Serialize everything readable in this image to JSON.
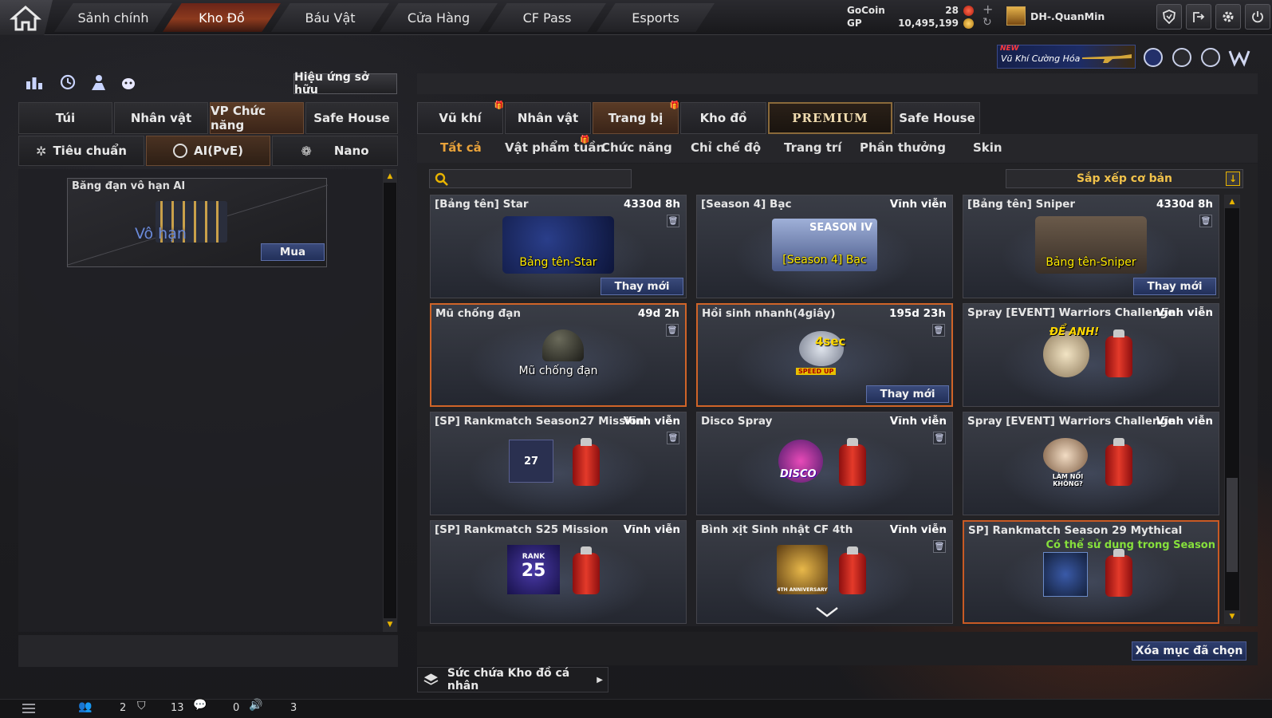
{
  "topbar": {
    "nav": [
      "Sảnh chính",
      "Kho Đồ",
      "Báu Vật",
      "Cửa Hàng",
      "CF Pass",
      "Esports"
    ],
    "active_nav": "Kho Đồ",
    "gocoin_label": "GoCoin",
    "gocoin_value": "28",
    "gp_label": "GP",
    "gp_value": "10,495,199",
    "username": "DH-.QuanMin",
    "buttons": [
      "shield-icon",
      "exit-arrow-icon",
      "gear-icon",
      "power-icon"
    ]
  },
  "banner": {
    "new_badge": "NEW",
    "text": "Vũ Khí Cường Hóa"
  },
  "left": {
    "effect_button": "Hiệu ứng sở hữu",
    "tabs": [
      "Túi",
      "Nhân vật",
      "VP Chức năng",
      "Safe House"
    ],
    "active_tab": "VP Chức năng",
    "subtabs": [
      "Tiêu chuẩn",
      "AI(PvE)",
      "Nano"
    ],
    "active_subtab": "AI(PvE)",
    "item": {
      "name": "Băng đạn vô hạn AI",
      "image_label": "Vô hạn",
      "buy_button": "Mua"
    }
  },
  "right": {
    "tabs": [
      "Vũ khí",
      "Nhân vật",
      "Trang bị",
      "Kho đồ",
      "PREMIUM",
      "Safe House"
    ],
    "active_tab": "Trang bị",
    "filters": [
      "Tất cả",
      "Vật phẩm tuần",
      "Chức năng",
      "Chỉ chế độ",
      "Trang trí",
      "Phần thưởng",
      "Skin"
    ],
    "active_filter": "Tất cả",
    "search_placeholder": "",
    "sort_label": "Sắp xếp cơ bản",
    "items": [
      {
        "name": "[Bảng tên] Star",
        "time": "4330d 8h",
        "label": "Bảng tên-Star",
        "button": "Thay mới"
      },
      {
        "name": "[Season 4] Bạc",
        "time": "Vĩnh viễn",
        "label": "[Season 4] Bạc",
        "badge": "SEASON IV"
      },
      {
        "name": "[Bảng tên] Sniper",
        "time": "4330d 8h",
        "label": "Bảng tên-Sniper",
        "button": "Thay mới"
      },
      {
        "name": "Mũ chống đạn",
        "time": "49d 2h",
        "label": "Mũ chống đạn"
      },
      {
        "name": "Hồi sinh nhanh(4giây)",
        "time": "195d 23h",
        "badge": "4sec",
        "sub_badge": "SPEED UP",
        "button": "Thay mới"
      },
      {
        "name": "Spray [EVENT] Warriors Challenge",
        "time": "Vĩnh viễn",
        "badge": "ĐỂ ANH!"
      },
      {
        "name": "[SP] Rankmatch Season27 Mission",
        "time": "Vĩnh viễn",
        "badge": "27"
      },
      {
        "name": "Disco Spray",
        "time": "Vĩnh viễn",
        "badge": "DISCO"
      },
      {
        "name": "Spray [EVENT] Warriors Challenge",
        "time": "Vĩnh viễn",
        "badge": "LÀM NỔI KHÔNG?"
      },
      {
        "name": "[SP] Rankmatch S25 Mission",
        "time": "Vĩnh viễn",
        "badge": "RANK",
        "sub_badge": "25"
      },
      {
        "name": "Bình xịt Sinh nhật CF 4th",
        "time": "Vĩnh viễn",
        "badge": "4TH ANNIVERSARY"
      },
      {
        "name": "SP] Rankmatch Season 29 Mythical",
        "note": "Có thể sử dụng trong Season"
      }
    ],
    "delete_button": "Xóa mục đã chọn",
    "capacity_label": "Sức chứa Kho đồ cá nhân"
  },
  "bottombar": {
    "count1": "2",
    "count2": "13",
    "count3": "0",
    "count4": "3"
  },
  "colors": {
    "accent_orange": "#d06428",
    "tab_active": "#5a3b26",
    "button_blue": "#2e3e6e",
    "note_green": "#86e03c"
  }
}
